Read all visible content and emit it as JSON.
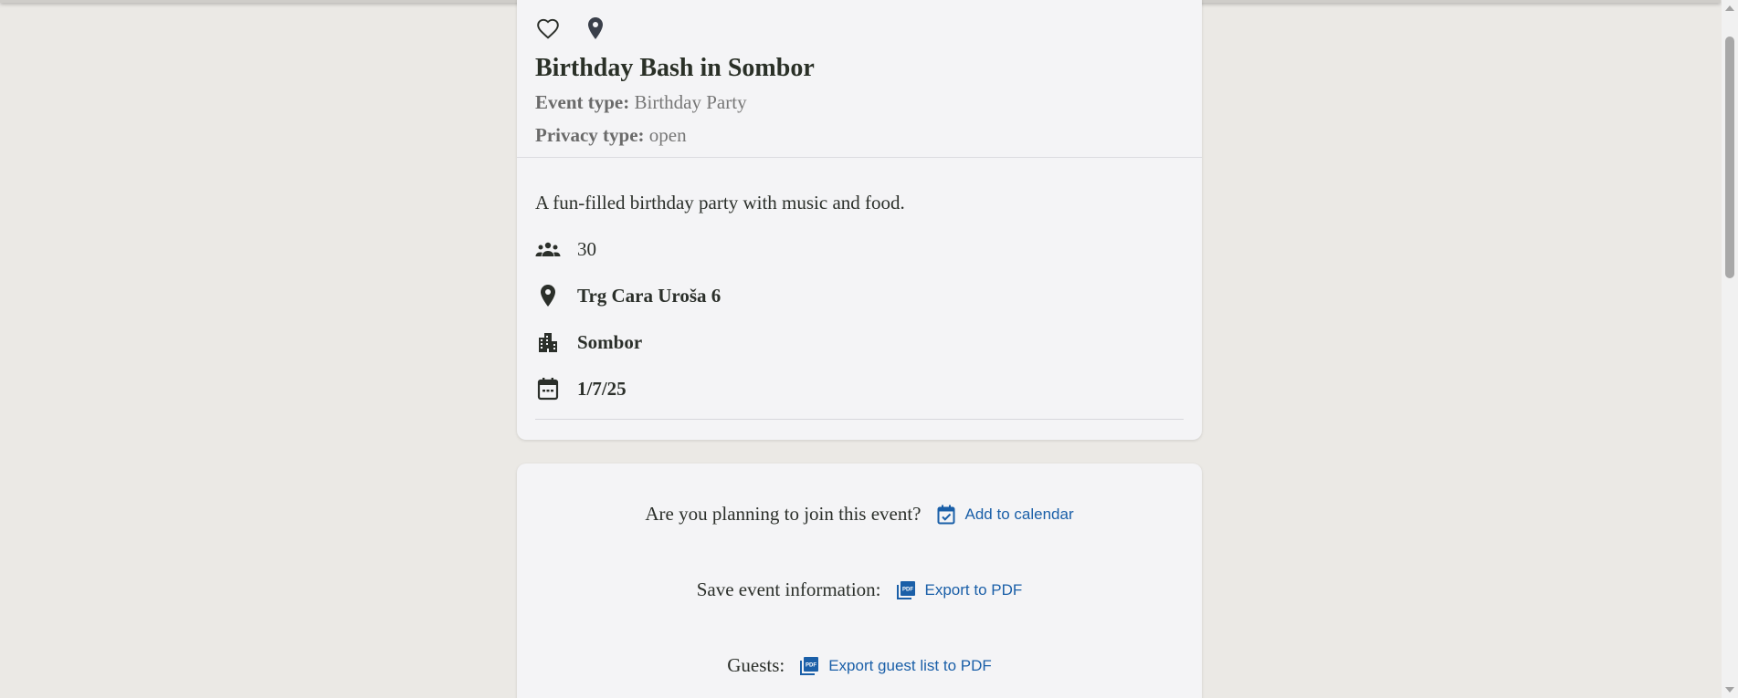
{
  "event": {
    "title": "Birthday Bash in Sombor",
    "event_type_label": "Event type:",
    "event_type_value": "Birthday Party",
    "privacy_type_label": "Privacy type:",
    "privacy_type_value": "open",
    "description": "A fun-filled birthday party with music and food.",
    "guests": "30",
    "address": "Trg Cara Uroša 6",
    "city": "Sombor",
    "date": "1/7/25"
  },
  "actions": {
    "join_prompt": "Are you planning to join this event?",
    "add_calendar": "Add to calendar",
    "save_prompt": "Save event information:",
    "export_pdf": "Export to PDF",
    "guests_prompt": "Guests:",
    "export_guests": "Export guest list to PDF"
  },
  "icons": {
    "favorite": "heart-outline-icon",
    "map": "map-pin-icon",
    "guests": "group-icon",
    "address": "map-pin-icon",
    "city": "city-buildings-icon",
    "date": "calendar-icon",
    "calendar_add": "calendar-check-icon",
    "pdf": "pdf-icon"
  },
  "colors": {
    "link": "#1a5fa8",
    "text": "#2b2f2a",
    "background": "#ebe9e5",
    "card": "#f4f4f6"
  }
}
